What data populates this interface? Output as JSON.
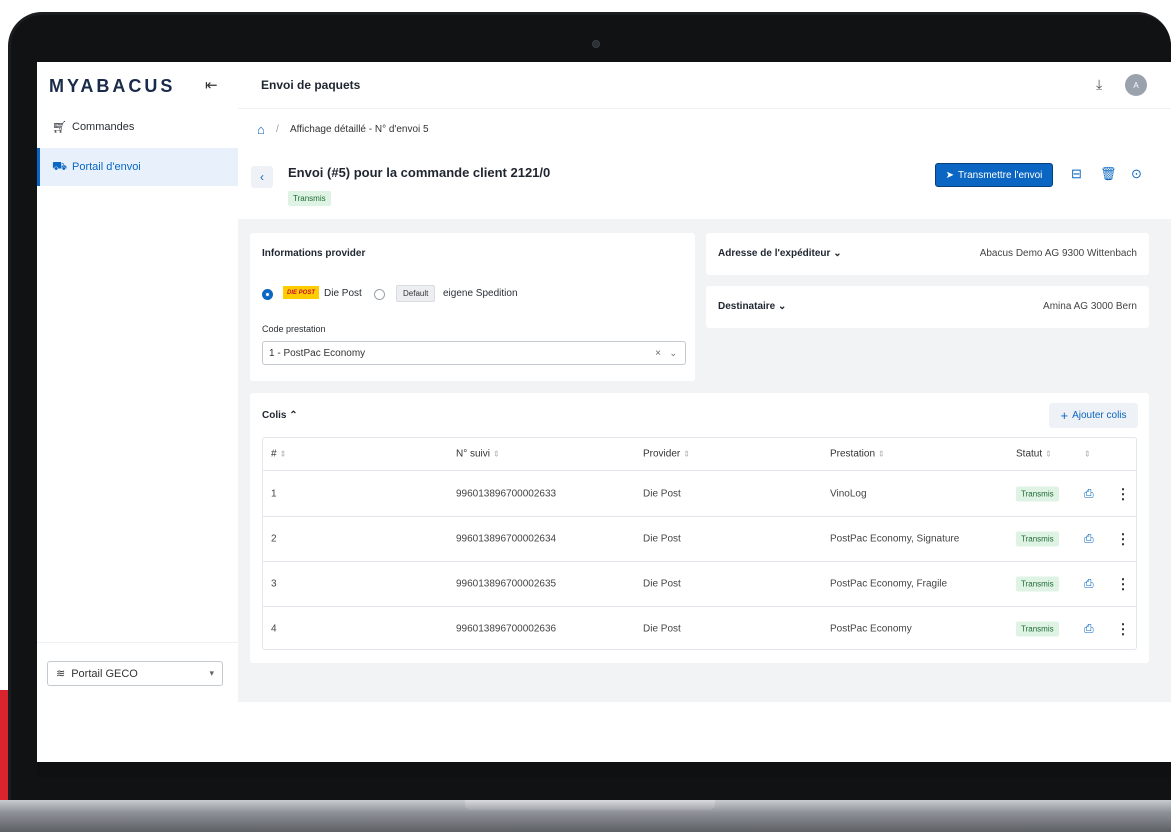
{
  "app": {
    "logo": "MYABACUS",
    "page_title": "Envoi de paquets",
    "avatar_initial": "A"
  },
  "sidebar": {
    "items": [
      {
        "label": "Commandes",
        "icon": "cart-icon",
        "active": false
      },
      {
        "label": "Portail d'envoi",
        "icon": "truck-icon",
        "active": true
      }
    ],
    "portal_select": "Portail GECO"
  },
  "breadcrumb": {
    "current": "Affichage détaillé - N° d'envoi 5"
  },
  "header": {
    "title": "Envoi (#5) pour la commande client 2121/0",
    "status": "Transmis",
    "transmit_label": "Transmettre l'envoi"
  },
  "provider": {
    "title": "Informations provider",
    "logo_text": "DIE POST",
    "option1": "Die Post",
    "option1_selected": true,
    "option2_tag": "Default",
    "option2": "eigene Spedition",
    "code_label": "Code prestation",
    "code_value": "1 - PostPac Economy"
  },
  "sender": {
    "label": "Adresse de l'expéditeur",
    "value": "Abacus Demo AG 9300 Wittenbach"
  },
  "recipient": {
    "label": "Destinataire",
    "value": "Amina AG 3000 Bern"
  },
  "parcels": {
    "title": "Colis",
    "add_label": "Ajouter colis",
    "columns": [
      "#",
      "N° suivi",
      "Provider",
      "Prestation",
      "Statut"
    ],
    "rows": [
      {
        "num": "1",
        "tracking": "996013896700002633",
        "provider": "Die Post",
        "service": "VinoLog",
        "status": "Transmis"
      },
      {
        "num": "2",
        "tracking": "996013896700002634",
        "provider": "Die Post",
        "service": "PostPac Economy, Signature",
        "status": "Transmis"
      },
      {
        "num": "3",
        "tracking": "996013896700002635",
        "provider": "Die Post",
        "service": "PostPac Economy, Fragile",
        "status": "Transmis"
      },
      {
        "num": "4",
        "tracking": "996013896700002636",
        "provider": "Die Post",
        "service": "PostPac Economy",
        "status": "Transmis"
      }
    ]
  },
  "colors": {
    "accent": "#0a66c2",
    "status_bg": "#dff3e4",
    "status_text": "#1e6b32",
    "post_yellow": "#ffcc00"
  }
}
